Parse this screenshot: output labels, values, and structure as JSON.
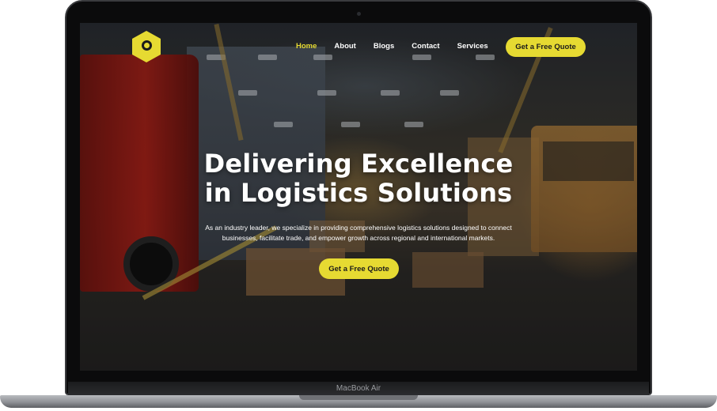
{
  "nav": {
    "items": [
      {
        "label": "Home",
        "active": true
      },
      {
        "label": "About",
        "active": false
      },
      {
        "label": "Blogs",
        "active": false
      },
      {
        "label": "Contact",
        "active": false
      },
      {
        "label": "Services",
        "active": false
      }
    ],
    "cta_label": "Get a Free Quote"
  },
  "logo": {
    "icon": "hexagon-logo-icon"
  },
  "hero": {
    "title_line1": "Delivering Excellence",
    "title_line2": "in Logistics Solutions",
    "subtitle": "As an industry leader, we specialize in providing comprehensive logistics solutions designed to connect businesses, facilitate trade, and empower growth across regional and international markets.",
    "cta_label": "Get a Free Quote"
  },
  "device": {
    "model_label": "MacBook Air"
  },
  "colors": {
    "accent": "#e6da32",
    "nav_active": "#e6da32",
    "text": "#ffffff",
    "button_text": "#1b1b1b"
  }
}
